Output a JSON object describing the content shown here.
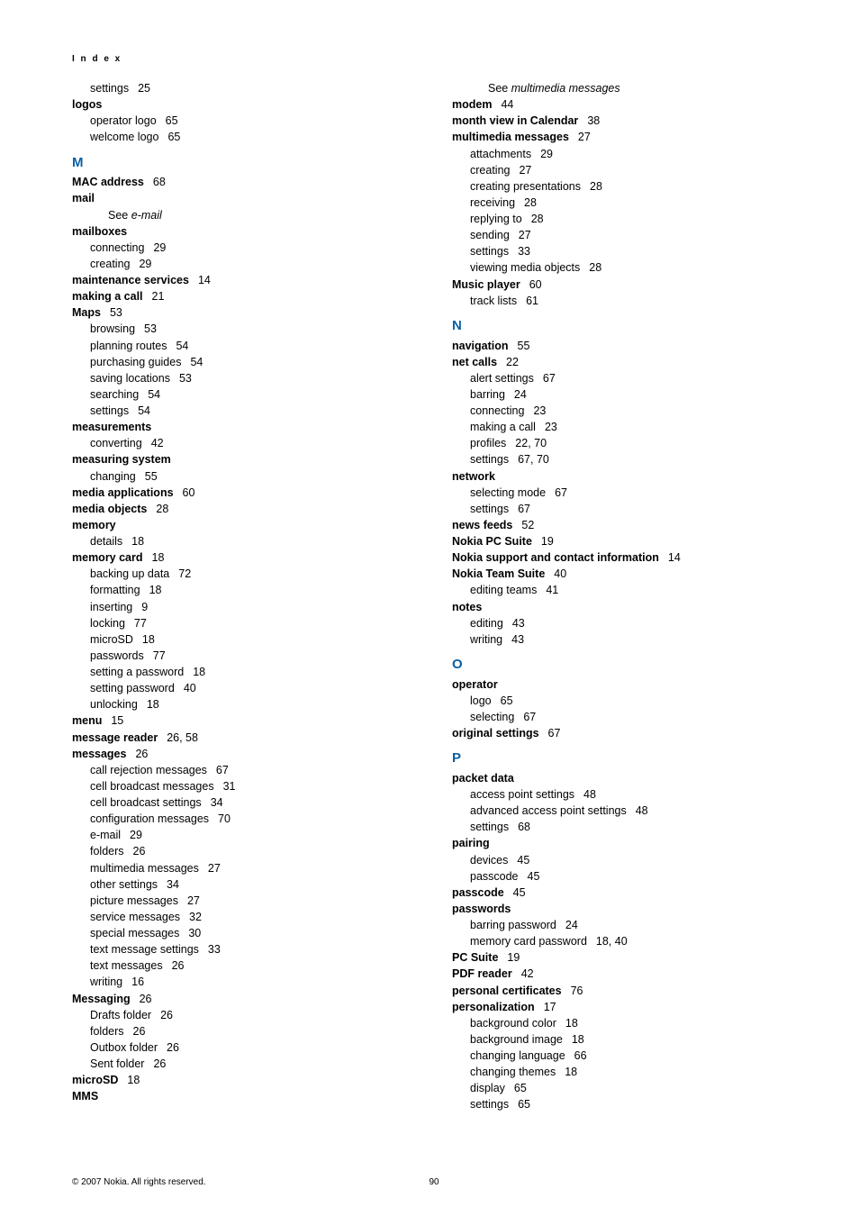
{
  "header": "I n d e x",
  "left": {
    "pre": [
      {
        "type": "sub",
        "label": "settings",
        "page": "25"
      },
      {
        "type": "topic",
        "label": "logos"
      },
      {
        "type": "sub",
        "label": "operator logo",
        "page": "65"
      },
      {
        "type": "sub",
        "label": "welcome logo",
        "page": "65"
      }
    ],
    "M_letter": "M",
    "M": [
      {
        "type": "topic",
        "label": "MAC address",
        "page": "68"
      },
      {
        "type": "topic",
        "label": "mail"
      },
      {
        "type": "see",
        "prefix": "See ",
        "ref": "e-mail"
      },
      {
        "type": "topic",
        "label": "mailboxes"
      },
      {
        "type": "sub",
        "label": "connecting",
        "page": "29"
      },
      {
        "type": "sub",
        "label": "creating",
        "page": "29"
      },
      {
        "type": "topic",
        "label": "maintenance services",
        "page": "14"
      },
      {
        "type": "topic",
        "label": "making a call",
        "page": "21"
      },
      {
        "type": "topic",
        "label": "Maps",
        "page": "53"
      },
      {
        "type": "sub",
        "label": "browsing",
        "page": "53"
      },
      {
        "type": "sub",
        "label": "planning routes",
        "page": "54"
      },
      {
        "type": "sub",
        "label": "purchasing guides",
        "page": "54"
      },
      {
        "type": "sub",
        "label": "saving locations",
        "page": "53"
      },
      {
        "type": "sub",
        "label": "searching",
        "page": "54"
      },
      {
        "type": "sub",
        "label": "settings",
        "page": "54"
      },
      {
        "type": "topic",
        "label": "measurements"
      },
      {
        "type": "sub",
        "label": "converting",
        "page": "42"
      },
      {
        "type": "topic",
        "label": "measuring system"
      },
      {
        "type": "sub",
        "label": "changing",
        "page": "55"
      },
      {
        "type": "topic",
        "label": "media applications",
        "page": "60"
      },
      {
        "type": "topic",
        "label": "media objects",
        "page": "28"
      },
      {
        "type": "topic",
        "label": "memory"
      },
      {
        "type": "sub",
        "label": "details",
        "page": "18"
      },
      {
        "type": "topic",
        "label": "memory card",
        "page": "18"
      },
      {
        "type": "sub",
        "label": "backing up data",
        "page": "72"
      },
      {
        "type": "sub",
        "label": "formatting",
        "page": "18"
      },
      {
        "type": "sub",
        "label": "inserting",
        "page": "9"
      },
      {
        "type": "sub",
        "label": "locking",
        "page": "77"
      },
      {
        "type": "sub",
        "label": "microSD",
        "page": "18"
      },
      {
        "type": "sub",
        "label": "passwords",
        "page": "77"
      },
      {
        "type": "sub",
        "label": "setting a password",
        "page": "18"
      },
      {
        "type": "sub",
        "label": "setting password",
        "page": "40"
      },
      {
        "type": "sub",
        "label": "unlocking",
        "page": "18"
      },
      {
        "type": "topic",
        "label": "menu",
        "page": "15"
      },
      {
        "type": "topic",
        "label": "message reader",
        "page": "26, 58"
      },
      {
        "type": "topic",
        "label": "messages",
        "page": "26"
      },
      {
        "type": "sub",
        "label": "call rejection messages",
        "page": "67"
      },
      {
        "type": "sub",
        "label": "cell broadcast messages",
        "page": "31"
      },
      {
        "type": "sub",
        "label": "cell broadcast settings",
        "page": "34"
      },
      {
        "type": "sub",
        "label": "configuration messages",
        "page": "70"
      },
      {
        "type": "sub",
        "label": "e-mail",
        "page": "29"
      },
      {
        "type": "sub",
        "label": "folders",
        "page": "26"
      },
      {
        "type": "sub",
        "label": "multimedia messages",
        "page": "27"
      },
      {
        "type": "sub",
        "label": "other settings",
        "page": "34"
      },
      {
        "type": "sub",
        "label": "picture messages",
        "page": "27"
      },
      {
        "type": "sub",
        "label": "service messages",
        "page": "32"
      },
      {
        "type": "sub",
        "label": "special messages",
        "page": "30"
      },
      {
        "type": "sub",
        "label": "text message settings",
        "page": "33"
      },
      {
        "type": "sub",
        "label": "text messages",
        "page": "26"
      },
      {
        "type": "sub",
        "label": "writing",
        "page": "16"
      },
      {
        "type": "topic",
        "label": "Messaging",
        "page": "26"
      },
      {
        "type": "sub",
        "label": "Drafts folder",
        "page": "26"
      },
      {
        "type": "sub",
        "label": "folders",
        "page": "26"
      },
      {
        "type": "sub",
        "label": "Outbox folder",
        "page": "26"
      },
      {
        "type": "sub",
        "label": "Sent folder",
        "page": "26"
      },
      {
        "type": "topic",
        "label": "microSD",
        "page": "18"
      },
      {
        "type": "topic",
        "label": "MMS"
      }
    ]
  },
  "right": {
    "pre": [
      {
        "type": "see",
        "prefix": "See ",
        "ref": "multimedia messages"
      },
      {
        "type": "topic",
        "label": "modem",
        "page": "44"
      },
      {
        "type": "topic",
        "label": "month view in Calendar",
        "page": "38"
      },
      {
        "type": "topic",
        "label": "multimedia messages",
        "page": "27"
      },
      {
        "type": "sub",
        "label": "attachments",
        "page": "29"
      },
      {
        "type": "sub",
        "label": "creating",
        "page": "27"
      },
      {
        "type": "sub",
        "label": "creating presentations",
        "page": "28"
      },
      {
        "type": "sub",
        "label": "receiving",
        "page": "28"
      },
      {
        "type": "sub",
        "label": "replying to",
        "page": "28"
      },
      {
        "type": "sub",
        "label": "sending",
        "page": "27"
      },
      {
        "type": "sub",
        "label": "settings",
        "page": "33"
      },
      {
        "type": "sub",
        "label": "viewing media objects",
        "page": "28"
      },
      {
        "type": "topic",
        "label": "Music player",
        "page": "60"
      },
      {
        "type": "sub",
        "label": "track lists",
        "page": "61"
      }
    ],
    "N_letter": "N",
    "N": [
      {
        "type": "topic",
        "label": "navigation",
        "page": "55"
      },
      {
        "type": "topic",
        "label": "net calls",
        "page": "22"
      },
      {
        "type": "sub",
        "label": "alert settings",
        "page": "67"
      },
      {
        "type": "sub",
        "label": "barring",
        "page": "24"
      },
      {
        "type": "sub",
        "label": "connecting",
        "page": "23"
      },
      {
        "type": "sub",
        "label": "making a call",
        "page": "23"
      },
      {
        "type": "sub",
        "label": "profiles",
        "page": "22, 70"
      },
      {
        "type": "sub",
        "label": "settings",
        "page": "67, 70"
      },
      {
        "type": "topic",
        "label": "network"
      },
      {
        "type": "sub",
        "label": "selecting mode",
        "page": "67"
      },
      {
        "type": "sub",
        "label": "settings",
        "page": "67"
      },
      {
        "type": "topic",
        "label": "news feeds",
        "page": "52"
      },
      {
        "type": "topic",
        "label": "Nokia PC Suite",
        "page": "19"
      },
      {
        "type": "topic",
        "label": "Nokia support and contact information",
        "page": "14"
      },
      {
        "type": "topic",
        "label": "Nokia Team Suite",
        "page": "40"
      },
      {
        "type": "sub",
        "label": "editing teams",
        "page": "41"
      },
      {
        "type": "topic",
        "label": "notes"
      },
      {
        "type": "sub",
        "label": "editing",
        "page": "43"
      },
      {
        "type": "sub",
        "label": "writing",
        "page": "43"
      }
    ],
    "O_letter": "O",
    "O": [
      {
        "type": "topic",
        "label": "operator"
      },
      {
        "type": "sub",
        "label": "logo",
        "page": "65"
      },
      {
        "type": "sub",
        "label": "selecting",
        "page": "67"
      },
      {
        "type": "topic",
        "label": "original settings",
        "page": "67"
      }
    ],
    "P_letter": "P",
    "P": [
      {
        "type": "topic",
        "label": "packet data"
      },
      {
        "type": "sub",
        "label": "access point settings",
        "page": "48"
      },
      {
        "type": "sub",
        "label": "advanced access point settings",
        "page": "48"
      },
      {
        "type": "sub",
        "label": "settings",
        "page": "68"
      },
      {
        "type": "topic",
        "label": "pairing"
      },
      {
        "type": "sub",
        "label": "devices",
        "page": "45"
      },
      {
        "type": "sub",
        "label": "passcode",
        "page": "45"
      },
      {
        "type": "topic",
        "label": "passcode",
        "page": "45"
      },
      {
        "type": "topic",
        "label": "passwords"
      },
      {
        "type": "sub",
        "label": "barring password",
        "page": "24"
      },
      {
        "type": "sub",
        "label": "memory card password",
        "page": "18, 40"
      },
      {
        "type": "topic",
        "label": "PC Suite",
        "page": "19"
      },
      {
        "type": "topic",
        "label": "PDF reader",
        "page": "42"
      },
      {
        "type": "topic",
        "label": "personal certificates",
        "page": "76"
      },
      {
        "type": "topic",
        "label": "personalization",
        "page": "17"
      },
      {
        "type": "sub",
        "label": "background color",
        "page": "18"
      },
      {
        "type": "sub",
        "label": "background image",
        "page": "18"
      },
      {
        "type": "sub",
        "label": "changing language",
        "page": "66"
      },
      {
        "type": "sub",
        "label": "changing themes",
        "page": "18"
      },
      {
        "type": "sub",
        "label": "display",
        "page": "65"
      },
      {
        "type": "sub",
        "label": "settings",
        "page": "65"
      }
    ]
  },
  "footer": {
    "copyright": "© 2007 Nokia. All rights reserved.",
    "page": "90"
  }
}
